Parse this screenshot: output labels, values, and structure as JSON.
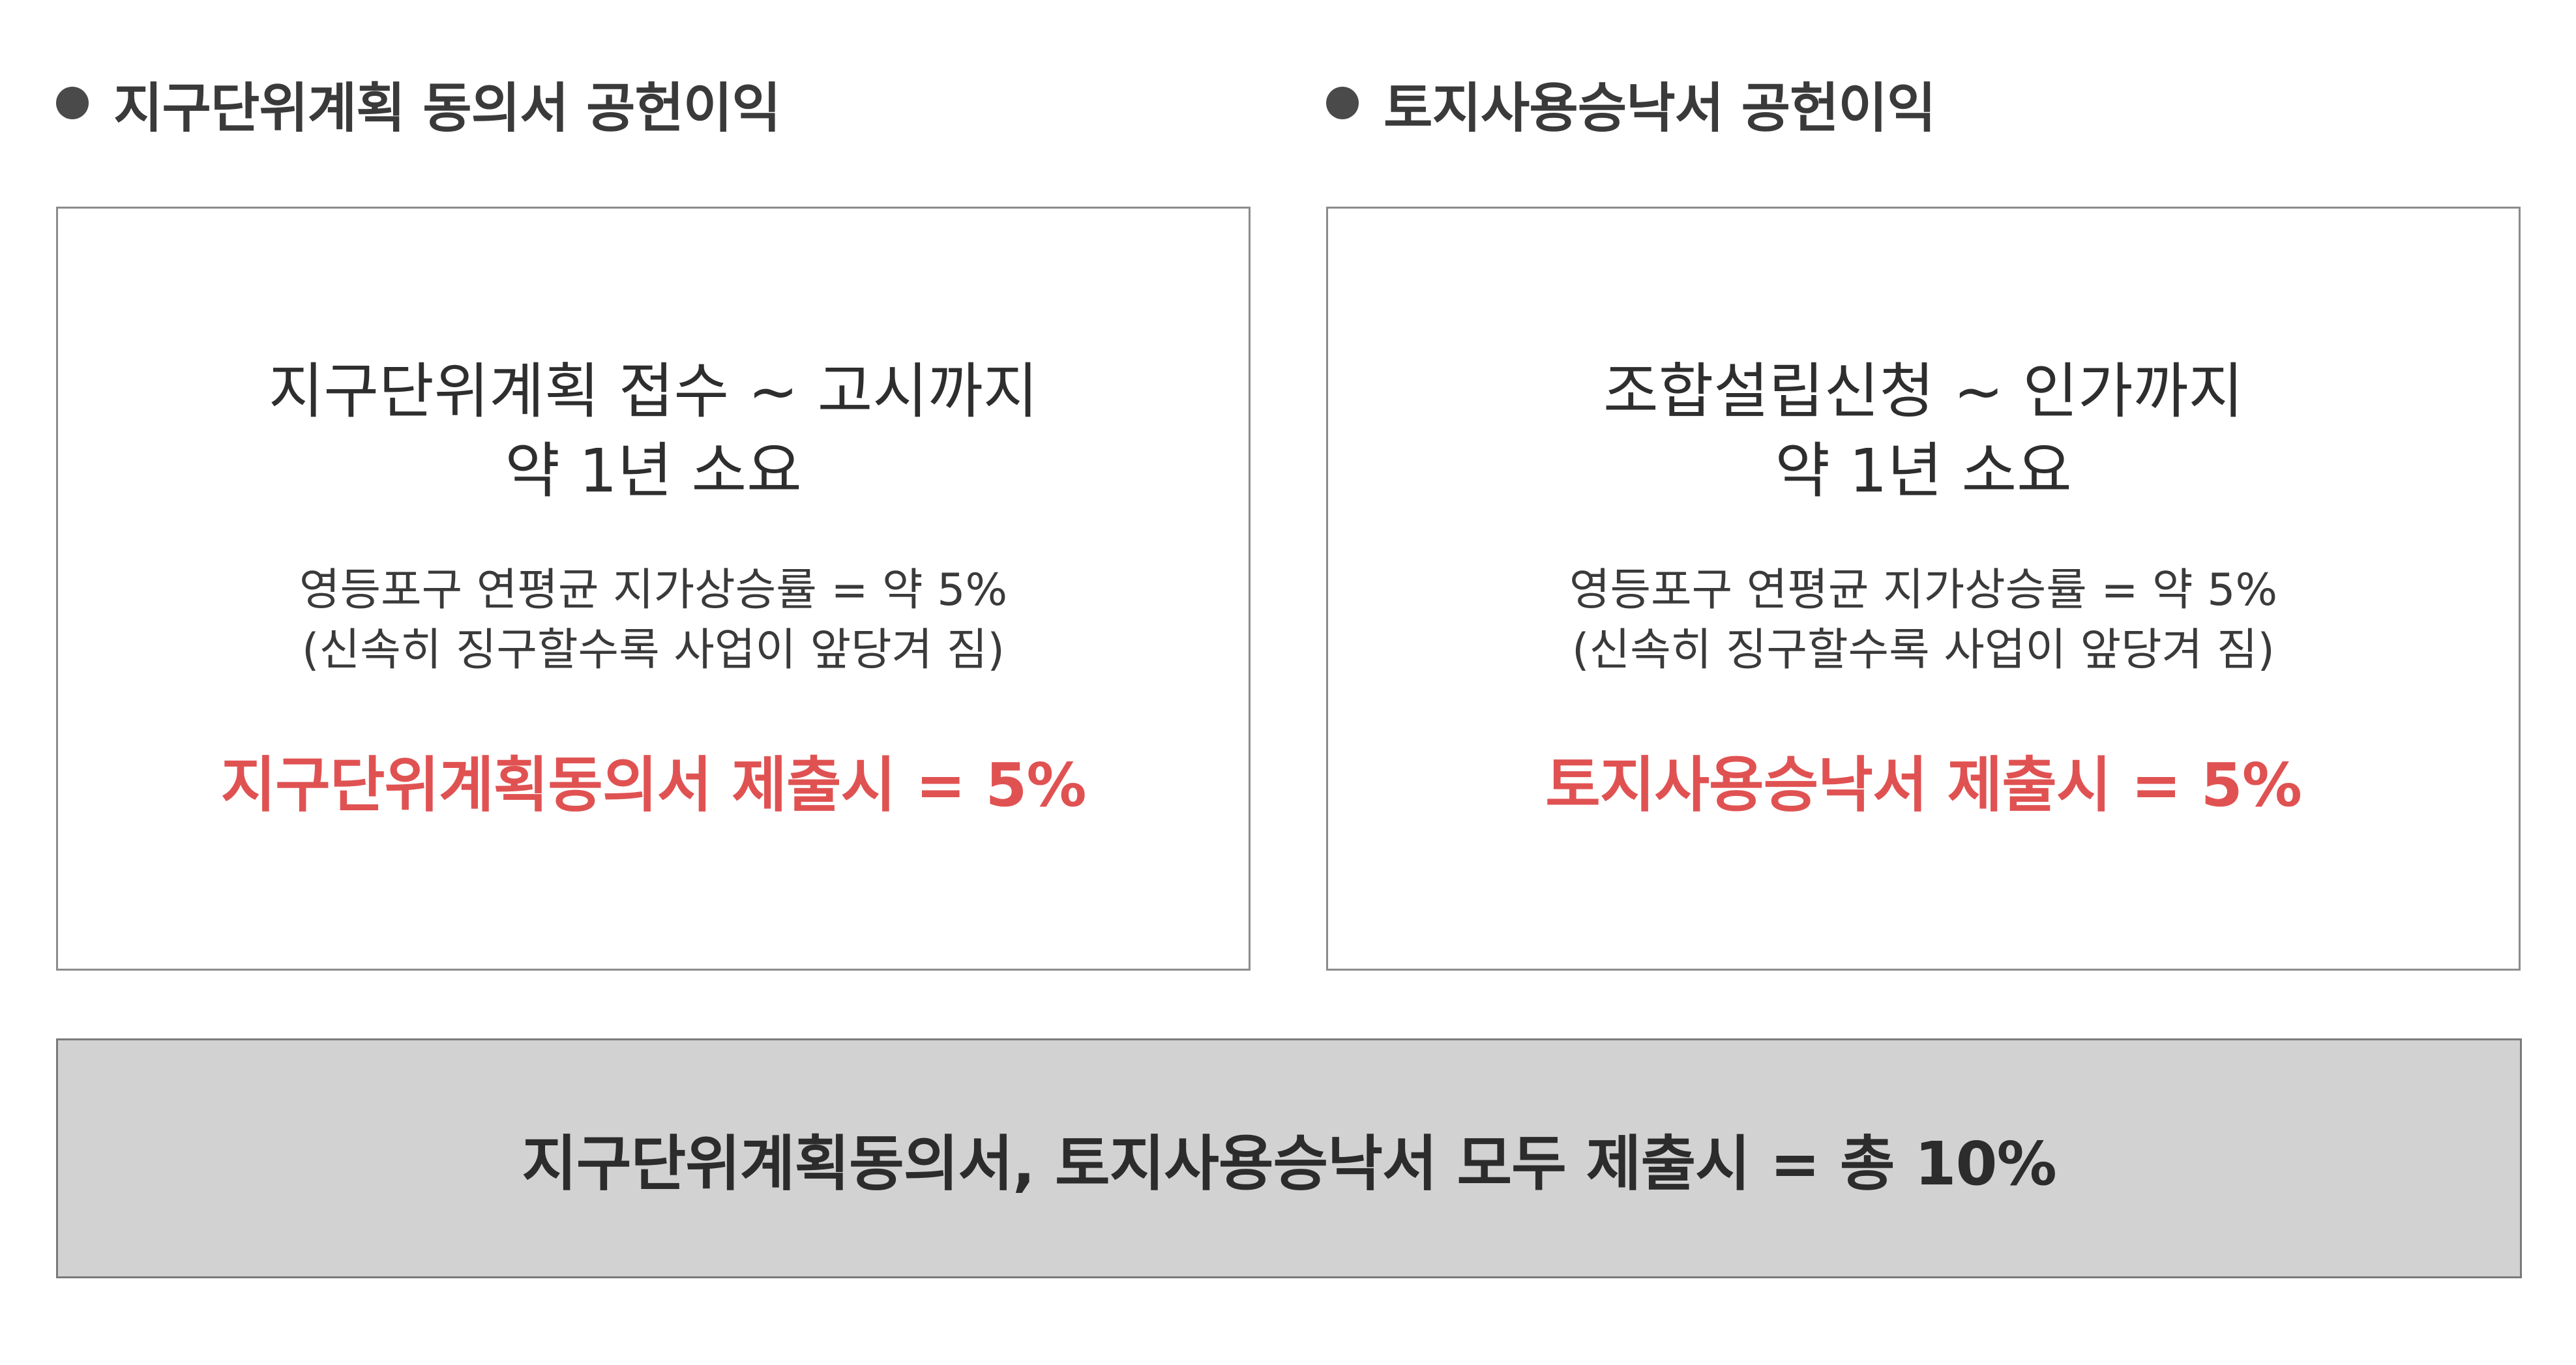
{
  "sections": [
    {
      "heading": "지구단위계획 동의서 공헌이익",
      "title_line1": "지구단위계획 접수 ~ 고시까지",
      "title_line2": "약 1년 소요",
      "note_line1": "영등포구 연평균 지가상승률 = 약 5%",
      "note_line2": "(신속히 징구할수록 사업이 앞당겨 짐)",
      "highlight": "지구단위계획동의서 제출시 = 5%"
    },
    {
      "heading": "토지사용승낙서 공헌이익",
      "title_line1": "조합설립신청 ~ 인가까지",
      "title_line2": "약 1년 소요",
      "note_line1": "영등포구 연평균 지가상승률 = 약 5%",
      "note_line2": "(신속히 징구할수록 사업이 앞당겨 짐)",
      "highlight": "토지사용승낙서 제출시 = 5%"
    }
  ],
  "summary": "지구단위계획동의서, 토지사용승낙서 모두 제출시 = 총 10%",
  "colors": {
    "highlight": "#e05252",
    "summary_background": "#d2d2d2",
    "bullet": "#4a4a4a",
    "card_border": "#8c8c8c"
  },
  "icons": {
    "bullet": "filled-circle-bullet"
  }
}
